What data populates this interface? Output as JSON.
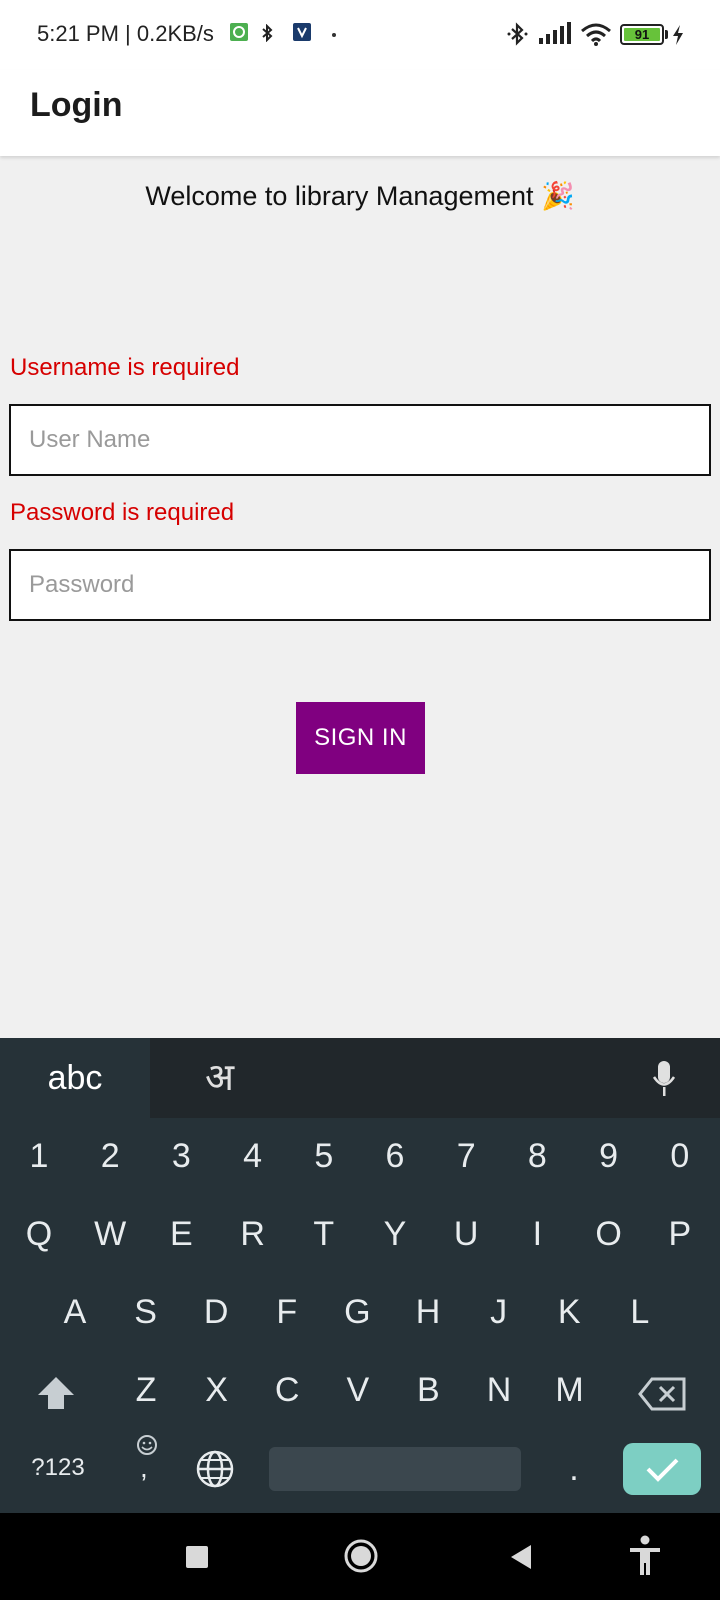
{
  "status_bar": {
    "time_speed": "5:21 PM | 0.2KB/s",
    "battery_level": "91"
  },
  "app_bar": {
    "title": "Login"
  },
  "main": {
    "welcome": "Welcome to library Management 🎉",
    "username_error": "Username is required",
    "username_placeholder": "User Name",
    "password_error": "Password is required",
    "password_placeholder": "Password",
    "signin_label": "SIGN IN"
  },
  "keyboard": {
    "tab_abc": "abc",
    "tab_hindi": "अ",
    "row_numbers": [
      "1",
      "2",
      "3",
      "4",
      "5",
      "6",
      "7",
      "8",
      "9",
      "0"
    ],
    "row_q": [
      "Q",
      "W",
      "E",
      "R",
      "T",
      "Y",
      "U",
      "I",
      "O",
      "P"
    ],
    "row_a": [
      "A",
      "S",
      "D",
      "F",
      "G",
      "H",
      "J",
      "K",
      "L"
    ],
    "row_z": [
      "Z",
      "X",
      "C",
      "V",
      "B",
      "N",
      "M"
    ],
    "symbols_label": "?123",
    "comma": ",",
    "period": "."
  },
  "colors": {
    "accent": "#800080",
    "error": "#d60000",
    "keyboard_bg": "#263238",
    "enter_key": "#7dcfc3"
  }
}
